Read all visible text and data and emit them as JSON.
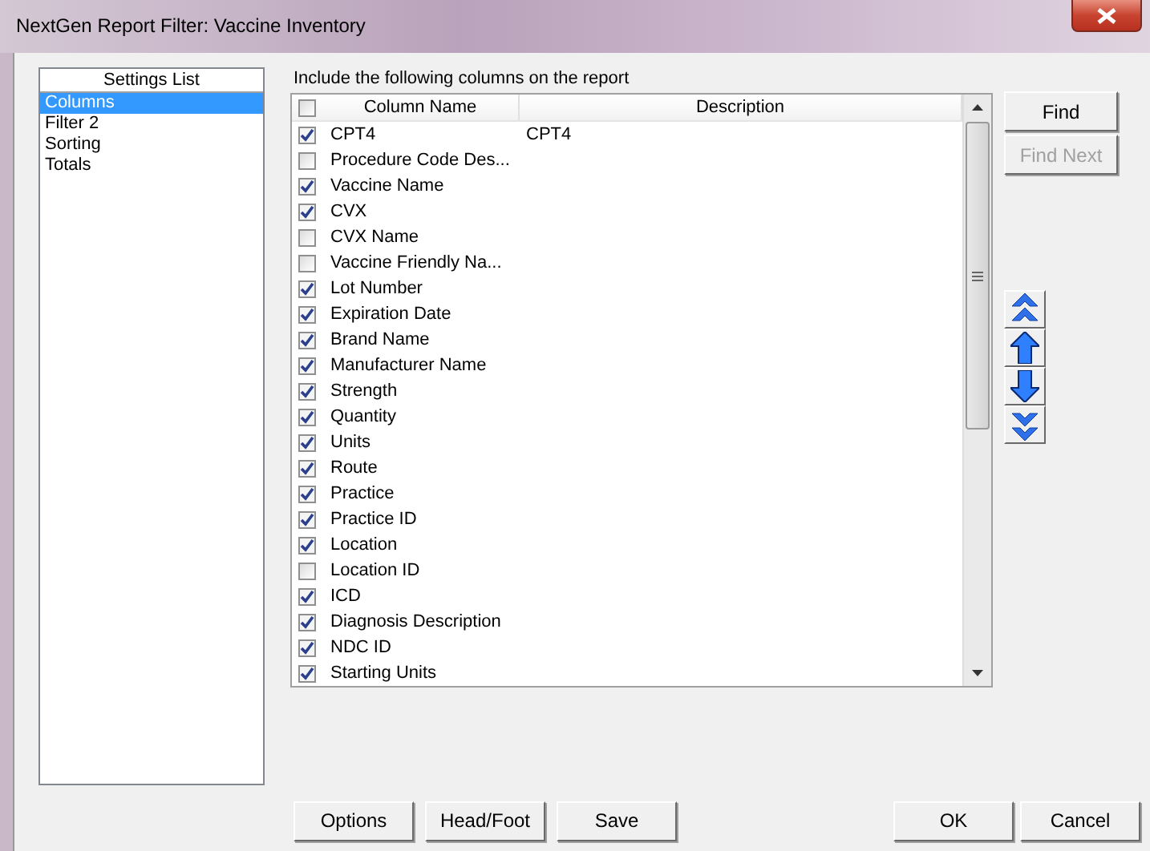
{
  "window": {
    "title": "NextGen Report Filter: Vaccine Inventory"
  },
  "settings_list": {
    "header": "Settings List",
    "items": [
      {
        "label": "Columns",
        "selected": true
      },
      {
        "label": "Filter 2",
        "selected": false
      },
      {
        "label": "Sorting",
        "selected": false
      },
      {
        "label": "Totals",
        "selected": false
      }
    ]
  },
  "columns_panel": {
    "label": "Include the following columns on the report",
    "header_checked": false,
    "headers": [
      "Column Name",
      "Description"
    ],
    "rows": [
      {
        "name": "CPT4",
        "description": "CPT4",
        "checked": true
      },
      {
        "name": "Procedure Code  Des...",
        "checked": false
      },
      {
        "name": "Vaccine Name",
        "checked": true
      },
      {
        "name": "CVX",
        "checked": true
      },
      {
        "name": "CVX Name",
        "checked": false
      },
      {
        "name": "Vaccine Friendly Na...",
        "checked": false
      },
      {
        "name": "Lot Number",
        "checked": true
      },
      {
        "name": "Expiration Date",
        "checked": true
      },
      {
        "name": "Brand Name",
        "checked": true
      },
      {
        "name": "Manufacturer Name",
        "checked": true
      },
      {
        "name": "Strength",
        "checked": true
      },
      {
        "name": "Quantity",
        "checked": true
      },
      {
        "name": "Units",
        "checked": true
      },
      {
        "name": "Route",
        "checked": true
      },
      {
        "name": "Practice",
        "checked": true
      },
      {
        "name": "Practice ID",
        "checked": true
      },
      {
        "name": "Location",
        "checked": true
      },
      {
        "name": "Location ID",
        "checked": false
      },
      {
        "name": "ICD",
        "checked": true
      },
      {
        "name": "Diagnosis Description",
        "checked": true
      },
      {
        "name": "NDC ID",
        "checked": true
      },
      {
        "name": "Starting Units",
        "checked": true
      }
    ]
  },
  "side_buttons": [
    {
      "label": "Find",
      "disabled": false
    },
    {
      "label": "Find Next",
      "disabled": true
    }
  ],
  "bottom_left_buttons": [
    "Options",
    "Head/Foot",
    "Save"
  ],
  "bottom_right_buttons": [
    "OK",
    "Cancel"
  ]
}
